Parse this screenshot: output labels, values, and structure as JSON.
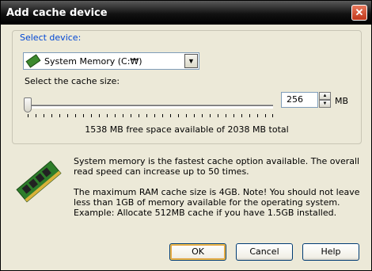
{
  "window": {
    "title": "Add cache device",
    "close_glyph": "✕"
  },
  "device": {
    "group_label": "Select device:",
    "selected": "System Memory (C:₩)",
    "icon": "memory-chip-icon",
    "dropdown_glyph": "▼"
  },
  "cache_size": {
    "label": "Select the cache size:",
    "value": "256",
    "unit": "MB",
    "free_space_text": "1538 MB free space available of 2038 MB total"
  },
  "info": {
    "icon": "ram-module-icon",
    "paragraph1": "System memory is the fastest cache option available. The overall read speed can increase up to 50 times.",
    "paragraph2": "The maximum RAM cache size is 4GB. Note! You should not leave less than 1GB of memory available for the operating system.",
    "paragraph3": "Example: Allocate 512MB cache if you have 1.5GB installed."
  },
  "buttons": {
    "ok": "OK",
    "cancel": "Cancel",
    "help": "Help"
  }
}
